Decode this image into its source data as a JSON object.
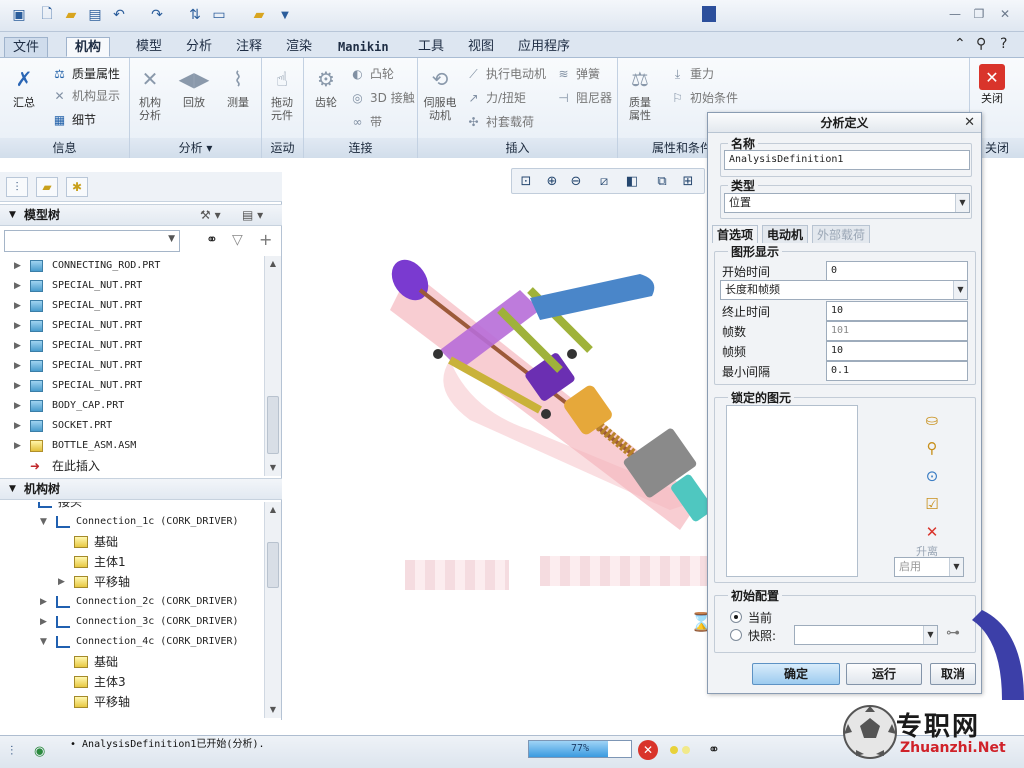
{
  "window": {
    "title": ""
  },
  "ribbon_tabs": [
    "文件",
    "机构",
    "模型",
    "分析",
    "注释",
    "渲染",
    "Manikin",
    "工具",
    "视图",
    "应用程序"
  ],
  "ribbon": {
    "info": {
      "title": "信息",
      "summary": "汇总",
      "mass_props": "质量属性",
      "mech_display": "机构显示",
      "detail": "细节"
    },
    "analysis": {
      "title": "分析",
      "mech_analysis": "机构\n分析",
      "playback": "回放",
      "measure": "测量"
    },
    "motion": {
      "title": "运动",
      "drag": "拖动\n元件"
    },
    "connection": {
      "title": "连接",
      "gear": "齿轮",
      "cam": "凸轮",
      "contact3d": "3D 接触",
      "belt": "带"
    },
    "insert": {
      "title": "插入",
      "servo": "伺服电\n动机",
      "exec_motor": "执行电动机",
      "force_torque": "力/扭矩",
      "bushing": "衬套载荷",
      "spring": "弹簧",
      "damper": "阻尼器"
    },
    "props": {
      "title": "属性和条件",
      "mass": "质量\n属性",
      "gravity": "重力",
      "init_cond": "初始条件"
    },
    "close": {
      "title": "关闭",
      "label": "关闭"
    }
  },
  "model_tree": {
    "title": "模型树",
    "items": [
      {
        "name": "CONNECTING_ROD.PRT",
        "type": "part"
      },
      {
        "name": "SPECIAL_NUT.PRT",
        "type": "part"
      },
      {
        "name": "SPECIAL_NUT.PRT",
        "type": "part"
      },
      {
        "name": "SPECIAL_NUT.PRT",
        "type": "part"
      },
      {
        "name": "SPECIAL_NUT.PRT",
        "type": "part"
      },
      {
        "name": "SPECIAL_NUT.PRT",
        "type": "part"
      },
      {
        "name": "SPECIAL_NUT.PRT",
        "type": "part"
      },
      {
        "name": "BODY_CAP.PRT",
        "type": "part"
      },
      {
        "name": "SOCKET.PRT",
        "type": "part"
      },
      {
        "name": "BOTTLE_ASM.ASM",
        "type": "asm"
      }
    ],
    "insert_here": "在此插入"
  },
  "mech_tree": {
    "title": "机构树",
    "items": [
      {
        "label": "接头",
        "level": 0
      },
      {
        "label": "Connection_1c  (CORK_DRIVER)",
        "level": 1,
        "exp": "▼"
      },
      {
        "label": "基础",
        "level": 2
      },
      {
        "label": "主体1",
        "level": 2
      },
      {
        "label": "平移轴",
        "level": 2,
        "exp": "▶"
      },
      {
        "label": "Connection_2c  (CORK_DRIVER)",
        "level": 1,
        "exp": "▶"
      },
      {
        "label": "Connection_3c  (CORK_DRIVER)",
        "level": 1,
        "exp": "▶"
      },
      {
        "label": "Connection_4c  (CORK_DRIVER)",
        "level": 1,
        "exp": "▼"
      },
      {
        "label": "基础",
        "level": 2
      },
      {
        "label": "主体3",
        "level": 2
      },
      {
        "label": "平移轴",
        "level": 2
      }
    ]
  },
  "dialog": {
    "title": "分析定义",
    "name_label": "名称",
    "name_value": "AnalysisDefinition1",
    "type_label": "类型",
    "type_value": "位置",
    "tabs": [
      "首选项",
      "电动机",
      "外部载荷"
    ],
    "graph_display": "图形显示",
    "start_label": "开始时间",
    "start_value": "0",
    "mode_value": "长度和帧频",
    "end_label": "终止时间",
    "end_value": "10",
    "frames_label": "帧数",
    "frames_value": "101",
    "rate_label": "帧频",
    "rate_value": "10",
    "min_label": "最小间隔",
    "min_value": "0.1",
    "locked_title": "锁定的图元",
    "upgrade": "升离",
    "enable_value": "启用",
    "init_title": "初始配置",
    "current": "当前",
    "snapshot": "快照:",
    "ok": "确定",
    "run": "运行",
    "cancel": "取消"
  },
  "status": {
    "message": "• AnalysisDefinition1已开始(分析).",
    "progress_percent": 77,
    "progress_text": "77%"
  },
  "brand": {
    "cjk": "专职网",
    "en": "Zhuanzhi.Net"
  },
  "colors": {
    "ribbon_bg": "#e7eef6",
    "accent": "#3a9ae0",
    "close_red": "#d9342b"
  }
}
